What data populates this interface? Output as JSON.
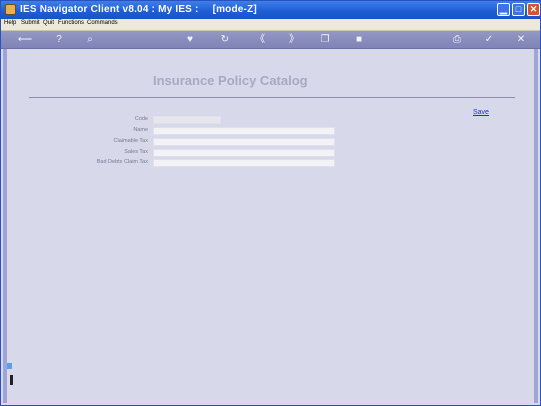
{
  "window": {
    "title": "IES Navigator Client v8.04 : My IES :",
    "mode": "[mode-Z]",
    "controls": {
      "minimize": "▁",
      "maximize": "□",
      "close": "✕"
    }
  },
  "menu": [
    "Help",
    "Submit",
    "Quit",
    "Functions",
    "Commands"
  ],
  "toolbar": {
    "back": "⟵",
    "help": "?",
    "search": "⌕",
    "favorite": "♥",
    "refresh": "↻",
    "prev": "《",
    "next": "》",
    "copy": "❐",
    "stop": "■",
    "print": "⎙",
    "ok": "✓",
    "cancel": "✕"
  },
  "form": {
    "title": "Insurance Policy Catalog",
    "save_label": "Save",
    "fields": [
      {
        "label": "Code",
        "value": ""
      },
      {
        "label": "Name",
        "value": ""
      },
      {
        "label": "Claimable Tax",
        "value": ""
      },
      {
        "label": "Sales Tax",
        "value": ""
      },
      {
        "label": "Bad Debts Claim Tax",
        "value": ""
      }
    ]
  },
  "colors": {
    "titlebar": "#1f5fd6",
    "toolbar": "#8a8ebc",
    "content_bg": "#d7d9ea",
    "link": "#2233cc"
  }
}
